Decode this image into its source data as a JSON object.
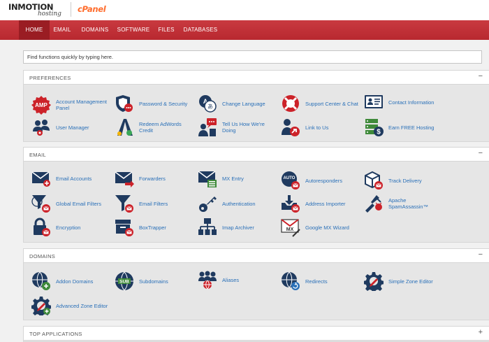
{
  "brand": {
    "inmotion_text": "INMOTION",
    "hosting_text": "hosting",
    "cpanel_text": "cPanel"
  },
  "nav": {
    "items": [
      {
        "label": "HOME",
        "active": true
      },
      {
        "label": "EMAIL"
      },
      {
        "label": "DOMAINS"
      },
      {
        "label": "SOFTWARE"
      },
      {
        "label": "FILES"
      },
      {
        "label": "DATABASES"
      }
    ]
  },
  "search": {
    "placeholder": "Find functions quickly by typing here."
  },
  "sections": {
    "preferences": {
      "title": "PREFERENCES",
      "toggle": "−",
      "items": [
        {
          "label": "Account Management Panel",
          "icon": "amp-icon"
        },
        {
          "label": "Password & Security",
          "icon": "shield-password-icon"
        },
        {
          "label": "Change Language",
          "icon": "language-icon"
        },
        {
          "label": "Support Center & Chat",
          "icon": "support-lifebuoy-icon"
        },
        {
          "label": "Contact Information",
          "icon": "contact-card-icon"
        },
        {
          "label": "User Manager",
          "icon": "user-manager-icon"
        },
        {
          "label": "Redeem AdWords Credit",
          "icon": "adwords-icon"
        },
        {
          "label": "Tell Us How We're Doing",
          "icon": "feedback-icon"
        },
        {
          "label": "Link to Us",
          "icon": "link-user-icon"
        },
        {
          "label": "Earn FREE Hosting",
          "icon": "earn-hosting-icon"
        }
      ]
    },
    "email": {
      "title": "EMAIL",
      "toggle": "−",
      "items": [
        {
          "label": "Email Accounts",
          "icon": "email-accounts-icon"
        },
        {
          "label": "Forwarders",
          "icon": "forwarders-icon"
        },
        {
          "label": "MX Entry",
          "icon": "mx-entry-icon"
        },
        {
          "label": "Autoresponders",
          "icon": "autoresponder-icon"
        },
        {
          "label": "Track Delivery",
          "icon": "track-delivery-icon"
        },
        {
          "label": "Global Email Filters",
          "icon": "global-filter-icon"
        },
        {
          "label": "Email Filters",
          "icon": "email-filter-icon"
        },
        {
          "label": "Authentication",
          "icon": "key-icon"
        },
        {
          "label": "Address Importer",
          "icon": "address-importer-icon"
        },
        {
          "label": "Apache SpamAssassin™",
          "icon": "spamassassin-icon"
        },
        {
          "label": "Encryption",
          "icon": "lock-icon"
        },
        {
          "label": "BoxTrapper",
          "icon": "boxtrapper-icon"
        },
        {
          "label": "Imap Archiver",
          "icon": "imap-archiver-icon"
        },
        {
          "label": "Google MX Wizard",
          "icon": "google-mx-icon"
        }
      ]
    },
    "domains": {
      "title": "DOMAINS",
      "toggle": "−",
      "items": [
        {
          "label": "Addon Domains",
          "icon": "addon-domains-icon"
        },
        {
          "label": "Subdomains",
          "icon": "subdomains-icon"
        },
        {
          "label": "Aliases",
          "icon": "aliases-icon"
        },
        {
          "label": "Redirects",
          "icon": "redirects-icon"
        },
        {
          "label": "Simple Zone Editor",
          "icon": "simple-zone-editor-icon"
        },
        {
          "label": "Advanced Zone Editor",
          "icon": "advanced-zone-editor-icon"
        }
      ]
    },
    "top_applications": {
      "title": "TOP APPLICATIONS",
      "toggle": "+"
    }
  },
  "colors": {
    "nav_red": "#c8353c",
    "nav_active": "#9a1d23",
    "icon_navy": "#1f3a5f",
    "icon_red": "#cc2229",
    "link_blue": "#2a70b8"
  }
}
